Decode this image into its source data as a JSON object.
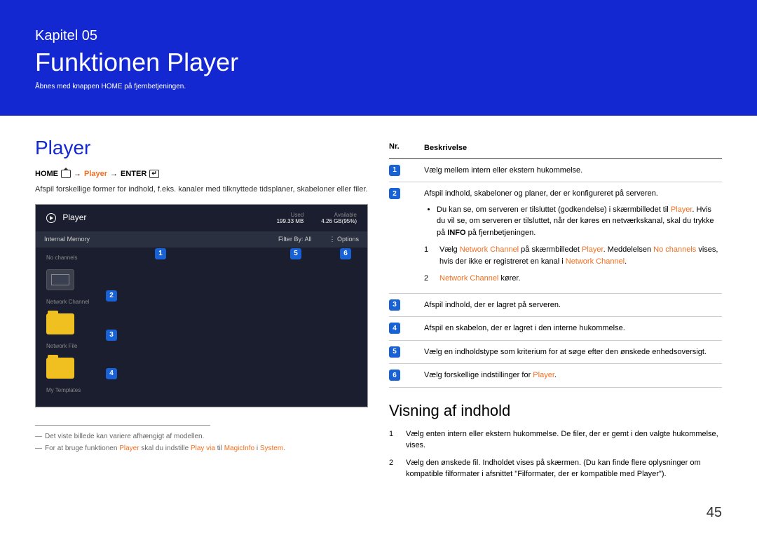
{
  "header": {
    "chapter_label": "Kapitel 05",
    "title": "Funktionen Player",
    "subtitle": "Åbnes med knappen HOME på fjernbetjeningen."
  },
  "left": {
    "section_title": "Player",
    "breadcrumb": {
      "home": "HOME",
      "arrow": "→",
      "player": "Player",
      "enter": "ENTER"
    },
    "intro": "Afspil forskellige former for indhold, f.eks. kanaler med tilknyttede tidsplaner, skabeloner eller filer.",
    "screenshot": {
      "title": "Player",
      "used_label": "Used",
      "used_value": "199.33 MB",
      "avail_label": "Available",
      "avail_value": "4.26 GB(95%)",
      "menu": {
        "internal": "Internal Memory",
        "filter": "Filter By: All",
        "options": "Options"
      },
      "items": [
        "No channels",
        "Network Channel",
        "Network File",
        "My Templates"
      ]
    },
    "footnotes": {
      "f1": "Det viste billede kan variere afhængigt af modellen.",
      "f2_prefix": "For at bruge funktionen ",
      "f2_player": "Player",
      "f2_mid": " skal du indstille ",
      "f2_playvia": "Play via",
      "f2_to": " til ",
      "f2_magic": "MagicInfo",
      "f2_in": " i ",
      "f2_system": "System",
      "f2_end": "."
    }
  },
  "right": {
    "table_headers": {
      "nr": "Nr.",
      "desc": "Beskrivelse"
    },
    "rows": [
      {
        "badge": "1",
        "text": "Vælg mellem intern eller ekstern hukommelse."
      },
      {
        "badge": "2",
        "text": "Afspil indhold, skabeloner og planer, der er konfigureret på serveren.",
        "bullets": [
          "Du kan se, om serveren er tilsluttet (godkendelse) i skærmbilledet til <orange>Player</orange>. Hvis du vil se, om serveren er tilsluttet, når der køres en netværkskanal, skal du trykke på <b>INFO</b> på fjernbetjeningen."
        ],
        "subs": [
          {
            "n": "1",
            "html": "Vælg <orange>Network Channel</orange> på skærmbilledet <orange>Player</orange>. Meddelelsen <orange>No channels</orange> vises, hvis der ikke er registreret en kanal i <orange>Network Channel</orange>."
          },
          {
            "n": "2",
            "html": "<orange>Network Channel</orange> kører."
          }
        ]
      },
      {
        "badge": "3",
        "text": "Afspil indhold, der er lagret på serveren."
      },
      {
        "badge": "4",
        "text": "Afspil en skabelon, der er lagret i den interne hukommelse."
      },
      {
        "badge": "5",
        "text": "Vælg en indholdstype som kriterium for at søge efter den ønskede enhedsoversigt."
      },
      {
        "badge": "6",
        "html": "Vælg forskellige indstillinger for <orange>Player</orange>."
      }
    ],
    "subsection_title": "Visning af indhold",
    "steps": [
      {
        "n": "1",
        "text": "Vælg enten intern eller ekstern hukommelse. De filer, der er gemt i den valgte hukommelse, vises."
      },
      {
        "n": "2",
        "text": "Vælg den ønskede fil. Indholdet vises på skærmen. (Du kan finde flere oplysninger om kompatible filformater i afsnittet \"Filformater, der er kompatible med Player\")."
      }
    ]
  },
  "page_number": "45"
}
